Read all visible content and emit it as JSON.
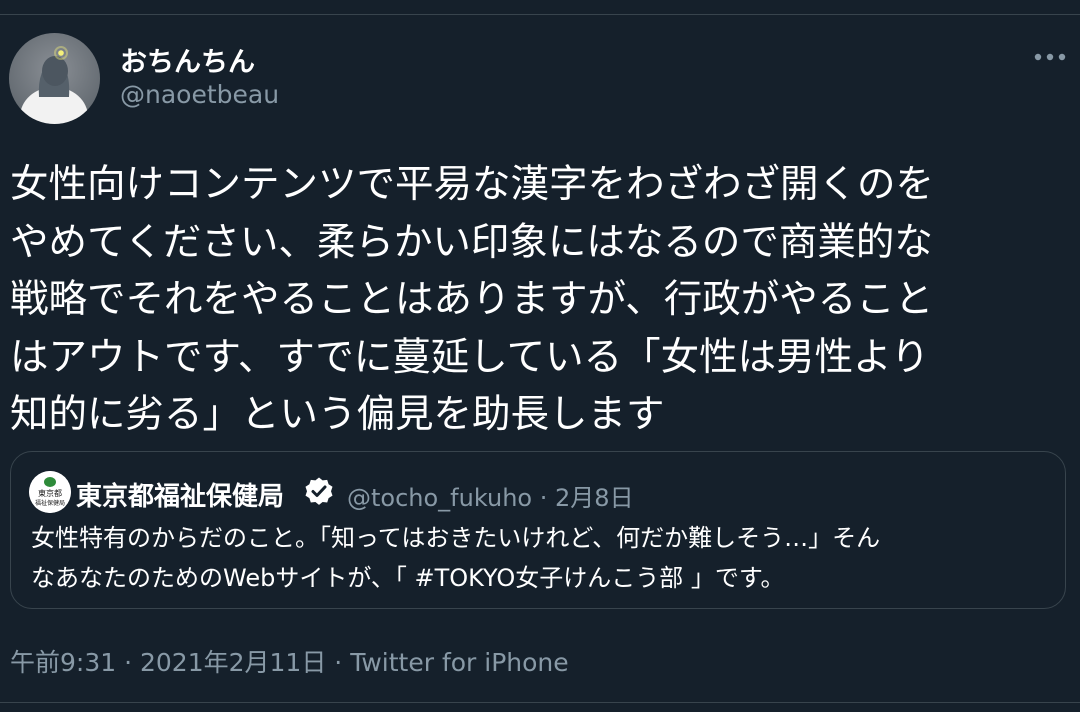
{
  "author": {
    "display_name": "おちんちん",
    "handle": "@naoetbeau",
    "avatar_icon": "pigeon-avatar-icon"
  },
  "more_icon": "more-options-icon",
  "tweet": {
    "lines": [
      "女性向けコンテンツで平易な漢字をわざわざ開くのを",
      "やめてください、柔らかい印象にはなるので商業的な",
      "戦略でそれをやることはありますが、行政がやること",
      "はアウトです、すでに蔓延している「女性は男性より",
      "知的に劣る」という偏見を助長します"
    ]
  },
  "quote": {
    "display_name": "東京都福祉保健局",
    "avatar_icon": "tokyo-logo-icon",
    "avatar_text": [
      "東京都",
      "福祉保健局"
    ],
    "verified_icon": "verified-badge-icon",
    "handle": "@tocho_fukuho",
    "separator": "·",
    "date": "2月8日",
    "lines": [
      "女性特有のからだのこと。「知ってはおきたいけれど、何だか難しそう…」そん",
      "なあなたのためのWebサイトが、「 #TOKYO女子けんこう部 」です。"
    ]
  },
  "footer": {
    "time": "午前9:31",
    "separator": "·",
    "date": "2021年2月11日",
    "source": "Twitter for iPhone"
  },
  "colors": {
    "background": "#15202b",
    "text": "#ffffff",
    "secondary_text": "#8899a6",
    "border": "#38444d",
    "verified": "#ffffff",
    "tokyo_green": "#2e8b3a"
  }
}
